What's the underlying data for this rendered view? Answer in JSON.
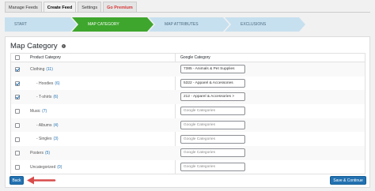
{
  "tabs": [
    {
      "label": "Manage Feeds"
    },
    {
      "label": "Create Feed"
    },
    {
      "label": "Settings"
    },
    {
      "label": "Go Premium"
    }
  ],
  "steps": [
    "START",
    "MAP CATEGORY",
    "MAP ATTRIBUTES",
    "EXCLUSIONS"
  ],
  "colors": {
    "step_active": "#3ea62d",
    "step_inactive": "#c7e0ef",
    "primary": "#2271b1",
    "premium": "#d63638",
    "arrow": "#d94b4b"
  },
  "panel": {
    "title": "Map Category",
    "help_icon": "question-icon"
  },
  "table": {
    "headers": [
      "Product Category",
      "Google Category"
    ],
    "rows": [
      {
        "name": "Clothing",
        "count": "(11)",
        "checked": true,
        "google": "7385 - Animals & Pet Supplies"
      },
      {
        "name": "- Hoodies",
        "count": "(6)",
        "checked": true,
        "google": "5322 - Apparel & Accessories"
      },
      {
        "name": "- T-shirts",
        "count": "(6)",
        "checked": true,
        "google": "212 - Apparel & Accessories >"
      },
      {
        "name": "Music",
        "count": "(7)",
        "checked": false,
        "google": "Google Categories"
      },
      {
        "name": "- Albums",
        "count": "(4)",
        "checked": false,
        "google": "Google Categories"
      },
      {
        "name": "- Singles",
        "count": "(3)",
        "checked": false,
        "google": "Google Categories"
      },
      {
        "name": "Posters",
        "count": "(5)",
        "checked": false,
        "google": "Google Categories"
      },
      {
        "name": "Uncategorized",
        "count": "(0)",
        "checked": false,
        "google": "Google Categories"
      }
    ]
  },
  "buttons": {
    "back": "Back",
    "save_continue": "Save & Continue"
  }
}
